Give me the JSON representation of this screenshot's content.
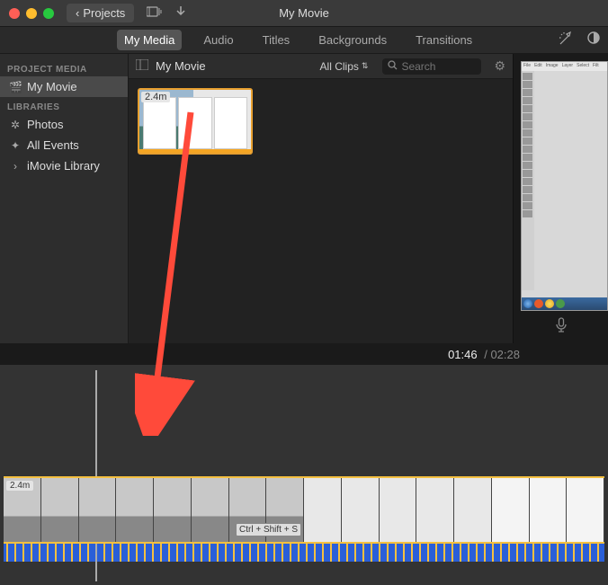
{
  "titlebar": {
    "back_label": "Projects",
    "app_title": "My Movie"
  },
  "tabs": [
    "My Media",
    "Audio",
    "Titles",
    "Backgrounds",
    "Transitions"
  ],
  "active_tab_index": 0,
  "sidebar": {
    "section1": "PROJECT MEDIA",
    "project": {
      "icon": "clapper-icon",
      "label": "My Movie"
    },
    "section2": "LIBRARIES",
    "items": [
      {
        "icon": "photos-icon",
        "label": "Photos"
      },
      {
        "icon": "star-icon",
        "label": "All Events"
      },
      {
        "icon": "disclosure-icon",
        "label": "iMovie Library"
      }
    ]
  },
  "browser": {
    "title": "My Movie",
    "filter_label": "All Clips",
    "search_placeholder": "Search",
    "clip_duration": "2.4m"
  },
  "preview_menus": [
    "File",
    "Edit",
    "Image",
    "Layer",
    "Select",
    "Filt"
  ],
  "timecode": {
    "current": "01:46",
    "total": "02:28"
  },
  "timeline": {
    "clip_duration": "2.4m",
    "shortcut_hint": "Ctrl + Shift + S"
  }
}
